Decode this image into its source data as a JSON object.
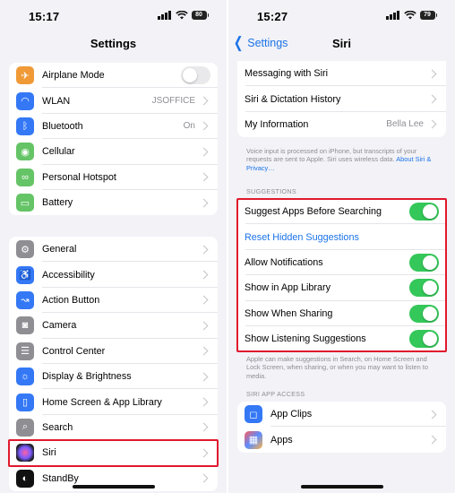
{
  "left": {
    "status_time": "15:17",
    "battery": "80",
    "title": "Settings",
    "group1": [
      {
        "label": "Airplane Mode",
        "icon": "airplane-icon",
        "color": "#f09a37",
        "toggle": false
      },
      {
        "label": "WLAN",
        "value": "JSOFFICE",
        "icon": "wifi-icon",
        "color": "#3478f6"
      },
      {
        "label": "Bluetooth",
        "value": "On",
        "icon": "bluetooth-icon",
        "color": "#3478f6"
      },
      {
        "label": "Cellular",
        "icon": "cellular-icon",
        "color": "#65c466"
      },
      {
        "label": "Personal Hotspot",
        "icon": "hotspot-icon",
        "color": "#65c466"
      },
      {
        "label": "Battery",
        "icon": "battery-icon",
        "color": "#65c466"
      }
    ],
    "group2": [
      {
        "label": "General",
        "icon": "gear-icon",
        "color": "#8e8e93"
      },
      {
        "label": "Accessibility",
        "icon": "accessibility-icon",
        "color": "#3478f6"
      },
      {
        "label": "Action Button",
        "icon": "action-button-icon",
        "color": "#3478f6"
      },
      {
        "label": "Camera",
        "icon": "camera-icon",
        "color": "#8e8e93"
      },
      {
        "label": "Control Center",
        "icon": "control-center-icon",
        "color": "#8e8e93"
      },
      {
        "label": "Display & Brightness",
        "icon": "brightness-icon",
        "color": "#3478f6"
      },
      {
        "label": "Home Screen & App Library",
        "icon": "home-screen-icon",
        "color": "#3478f6"
      },
      {
        "label": "Search",
        "icon": "search-icon",
        "color": "#8e8e93"
      },
      {
        "label": "Siri",
        "icon": "siri-icon",
        "color": "#222222"
      },
      {
        "label": "StandBy",
        "icon": "standby-icon",
        "color": "#111111"
      }
    ]
  },
  "right": {
    "status_time": "15:27",
    "battery": "79",
    "back_label": "Settings",
    "title": "Siri",
    "group1": [
      {
        "label": "Messaging with Siri"
      },
      {
        "label": "Siri & Dictation History"
      },
      {
        "label": "My Information",
        "value": "Bella Lee"
      }
    ],
    "footnote1": "Voice input is processed on iPhone, but transcripts of your requests are sent to Apple. Siri uses wireless data.",
    "footnote1_link": "About Siri & Privacy…",
    "suggestions_header": "SUGGESTIONS",
    "suggestions": [
      {
        "label": "Suggest Apps Before Searching",
        "toggle": true
      },
      {
        "label": "Reset Hidden Suggestions",
        "link": true
      },
      {
        "label": "Allow Notifications",
        "toggle": true
      },
      {
        "label": "Show in App Library",
        "toggle": true
      },
      {
        "label": "Show When Sharing",
        "toggle": true
      },
      {
        "label": "Show Listening Suggestions",
        "toggle": true
      }
    ],
    "footnote2": "Apple can make suggestions in Search, on Home Screen and Lock Screen, when sharing, or when you may want to listen to media.",
    "app_access_header": "SIRI APP ACCESS",
    "app_access": [
      {
        "label": "App Clips",
        "icon": "app-clips-icon",
        "color": "#3478f6"
      },
      {
        "label": "Apps",
        "icon": "apps-grid-icon",
        "color": "#5b5bd6"
      }
    ]
  },
  "colors": {
    "accent": "#1a73e8",
    "toggle_on": "#34c759",
    "highlight": "#e0192d"
  }
}
